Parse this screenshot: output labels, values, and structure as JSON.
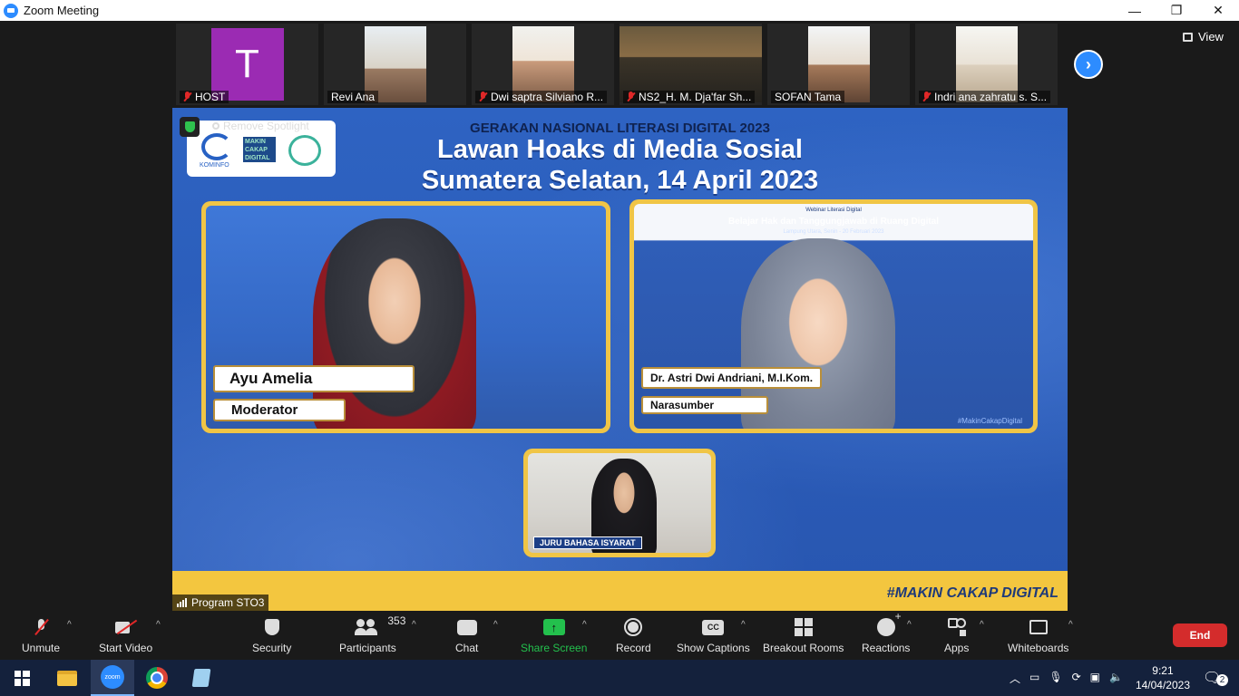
{
  "window": {
    "title": "Zoom Meeting",
    "controls": [
      "—",
      "❐",
      "✕"
    ]
  },
  "strip": {
    "participants": [
      {
        "name": "HOST",
        "muted": true,
        "avatar_letter": "T"
      },
      {
        "name": "Revi Ana",
        "muted": false
      },
      {
        "name": "Dwi saptra Silviano R...",
        "muted": true
      },
      {
        "name": "NS2_H. M. Dja'far Sh...",
        "muted": true
      },
      {
        "name": "SOFAN Tama",
        "muted": false
      },
      {
        "name": "Indri ana zahratu s. S...",
        "muted": true
      }
    ],
    "view_label": "View"
  },
  "stage": {
    "remove_spotlight": "Remove Spotlight",
    "logo_kominfo": "KOMINFO",
    "logo_makin": "MAKIN CAKAP DIGITAL",
    "headline_small": "GERAKAN NASIONAL LITERASI DIGITAL 2023",
    "headline_1": "Lawan Hoaks di Media Sosial",
    "headline_2": "Sumatera Selatan, 14 April 2023",
    "moderator_name": "Ayu Amelia",
    "moderator_role": "Moderator",
    "speaker_name": "Dr. Astri Dwi Andriani, M.I.Kom.",
    "speaker_role": "Narasumber",
    "webinar_sub": "Webinar Literasi Digital",
    "webinar_title": "Belajar Hak dan Tanggungjawab di Ruang Digital",
    "webinar_date": "Lampung Utara, Senin - 20 Februari 2023",
    "mini_hashtag": "#MakinCakapDigital",
    "interpreter_tag": "JURU BAHASA ISYARAT",
    "hashtag": "#MAKIN CAKAP DIGITAL",
    "program_tag": "Program STO3"
  },
  "toolbar": {
    "unmute": "Unmute",
    "start_video": "Start Video",
    "security": "Security",
    "participants": "Participants",
    "participants_count": "353",
    "chat": "Chat",
    "share_screen": "Share Screen",
    "record": "Record",
    "show_captions": "Show Captions",
    "cc": "CC",
    "breakout_rooms": "Breakout Rooms",
    "reactions": "Reactions",
    "apps": "Apps",
    "whiteboards": "Whiteboards",
    "end": "End"
  },
  "taskbar": {
    "zoom_icon_text": "zoom",
    "time": "9:21",
    "date": "14/04/2023",
    "notifications": "2"
  },
  "colors": {
    "accent_blue": "#2d8cff",
    "share_green": "#23c04d",
    "end_red": "#d42c2c",
    "muted_red": "#e02828",
    "banner_yellow": "#f3c63f"
  }
}
